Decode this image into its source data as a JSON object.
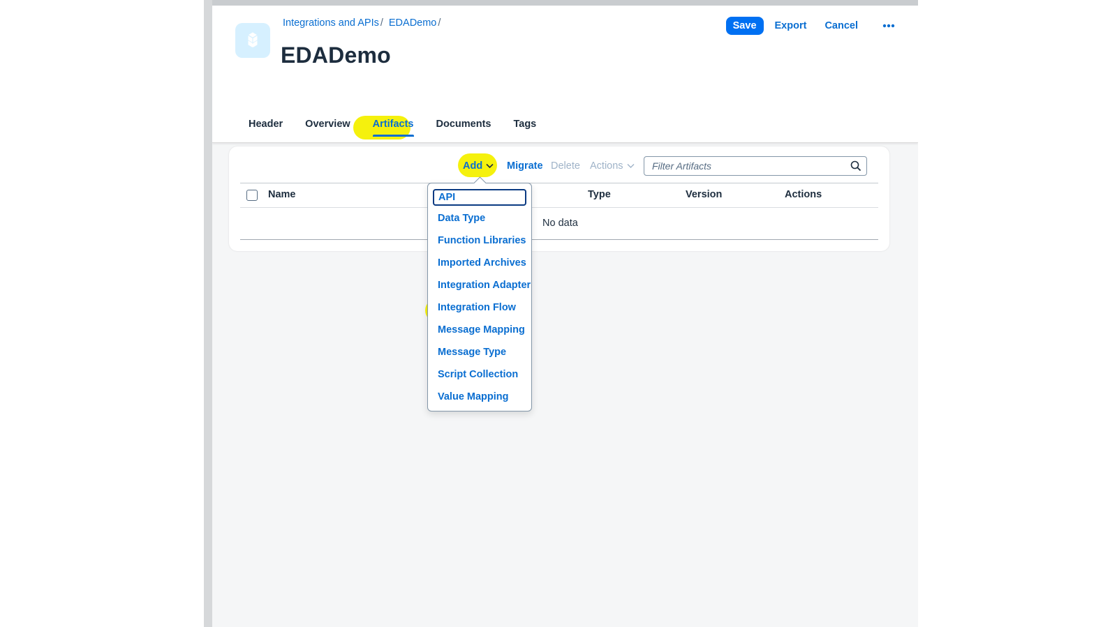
{
  "breadcrumb": {
    "items": [
      "Integrations and APIs",
      "EDADemo"
    ],
    "separator": "/"
  },
  "page": {
    "title": "EDADemo",
    "icon": "package-icon"
  },
  "header_actions": {
    "save_label": "Save",
    "export_label": "Export",
    "cancel_label": "Cancel",
    "overflow_icon": "more-horizontal-icon"
  },
  "tabs": [
    {
      "label": "Header"
    },
    {
      "label": "Overview"
    },
    {
      "label": "Artifacts",
      "selected": true
    },
    {
      "label": "Documents"
    },
    {
      "label": "Tags"
    }
  ],
  "toolbar": {
    "add_label": "Add",
    "migrate_label": "Migrate",
    "delete_label": "Delete",
    "actions_label": "Actions",
    "filter_placeholder": "Filter Artifacts"
  },
  "table": {
    "columns": [
      "Name",
      "Type",
      "Version",
      "Actions"
    ],
    "empty_text": "No data"
  },
  "add_menu": {
    "items": [
      "API",
      "Data Type",
      "Function Libraries",
      "Imported Archives",
      "Integration Adapter",
      "Integration Flow",
      "Message Mapping",
      "Message Type",
      "Script Collection",
      "Value Mapping"
    ],
    "focused_index": 0,
    "highlighted_index": 5
  },
  "colors": {
    "accent": "#0a6ed1",
    "primary_button": "#0070f2",
    "highlight": "#f4f000",
    "background": "#f5f6f7",
    "text": "#1d2d3e"
  }
}
